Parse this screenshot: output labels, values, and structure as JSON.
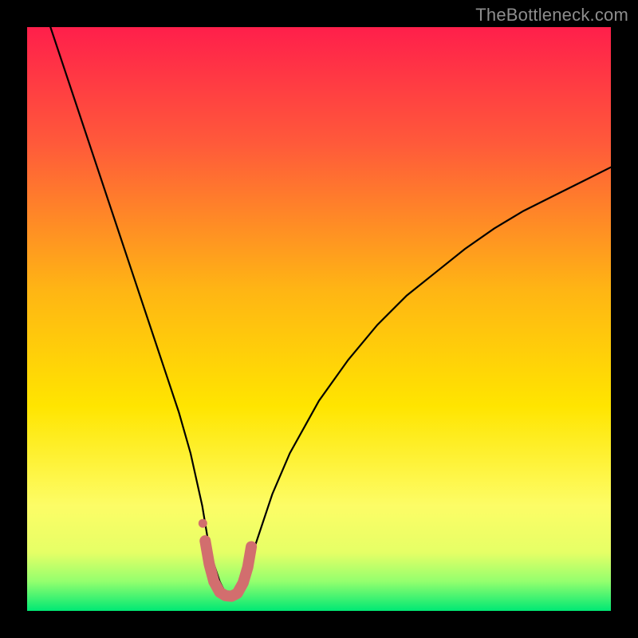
{
  "watermark": "TheBottleneck.com",
  "layout": {
    "image_size": 800,
    "border": 34,
    "plot_size": 732
  },
  "colors": {
    "frame": "#000000",
    "watermark": "#8d8d8d",
    "gradient_stops": [
      {
        "pct": 0,
        "color": "#ff1f4b"
      },
      {
        "pct": 20,
        "color": "#ff5a3a"
      },
      {
        "pct": 45,
        "color": "#ffb514"
      },
      {
        "pct": 65,
        "color": "#ffe500"
      },
      {
        "pct": 82,
        "color": "#fdfd66"
      },
      {
        "pct": 90,
        "color": "#e6ff66"
      },
      {
        "pct": 95,
        "color": "#93ff6e"
      },
      {
        "pct": 100,
        "color": "#00e874"
      }
    ],
    "curve": "#000000",
    "worm": "#d26e6e"
  },
  "chart_data": {
    "type": "line",
    "title": "",
    "xlabel": "",
    "ylabel": "",
    "xlim": [
      0,
      100
    ],
    "ylim": [
      0,
      100
    ],
    "grid": false,
    "legend": false,
    "series": [
      {
        "name": "bottleneck-curve",
        "x": [
          4,
          6,
          8,
          10,
          12,
          14,
          16,
          18,
          20,
          22,
          24,
          26,
          28,
          30,
          31,
          32,
          33,
          34,
          35,
          36,
          37,
          38,
          40,
          42,
          45,
          50,
          55,
          60,
          65,
          70,
          75,
          80,
          85,
          90,
          95,
          100
        ],
        "y": [
          100,
          94,
          88,
          82,
          76,
          70,
          64,
          58,
          52,
          46,
          40,
          34,
          27,
          18,
          12,
          8,
          5,
          3,
          2.5,
          3,
          5,
          8,
          14,
          20,
          27,
          36,
          43,
          49,
          54,
          58,
          62,
          65.5,
          68.5,
          71,
          73.5,
          76
        ]
      },
      {
        "name": "bottom-worm",
        "x": [
          30.5,
          31.2,
          32.0,
          33.0,
          34.0,
          35.0,
          36.0,
          37.0,
          37.8,
          38.4
        ],
        "y": [
          12.0,
          8.0,
          5.0,
          3.2,
          2.6,
          2.5,
          3.0,
          4.8,
          7.5,
          11.0
        ]
      }
    ],
    "annotations": []
  }
}
